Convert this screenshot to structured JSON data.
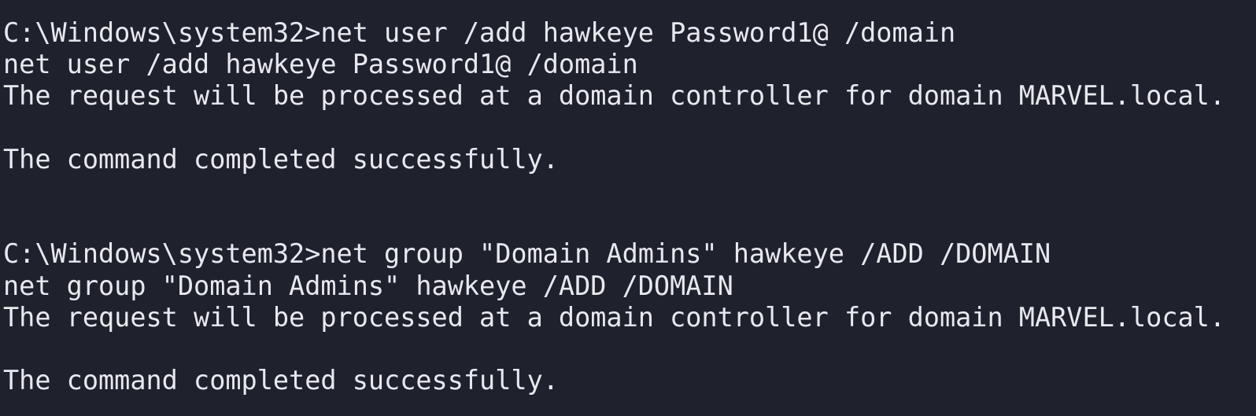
{
  "terminal": {
    "lines": [
      "C:\\Windows\\system32>net user /add hawkeye Password1@ /domain",
      "net user /add hawkeye Password1@ /domain",
      "The request will be processed at a domain controller for domain MARVEL.local.",
      "",
      "The command completed successfully.",
      "",
      "",
      "C:\\Windows\\system32>net group \"Domain Admins\" hawkeye /ADD /DOMAIN",
      "net group \"Domain Admins\" hawkeye /ADD /DOMAIN",
      "The request will be processed at a domain controller for domain MARVEL.local.",
      "",
      "The command completed successfully."
    ]
  },
  "colors": {
    "background": "#1f222d",
    "text": "#e8e9ee"
  }
}
